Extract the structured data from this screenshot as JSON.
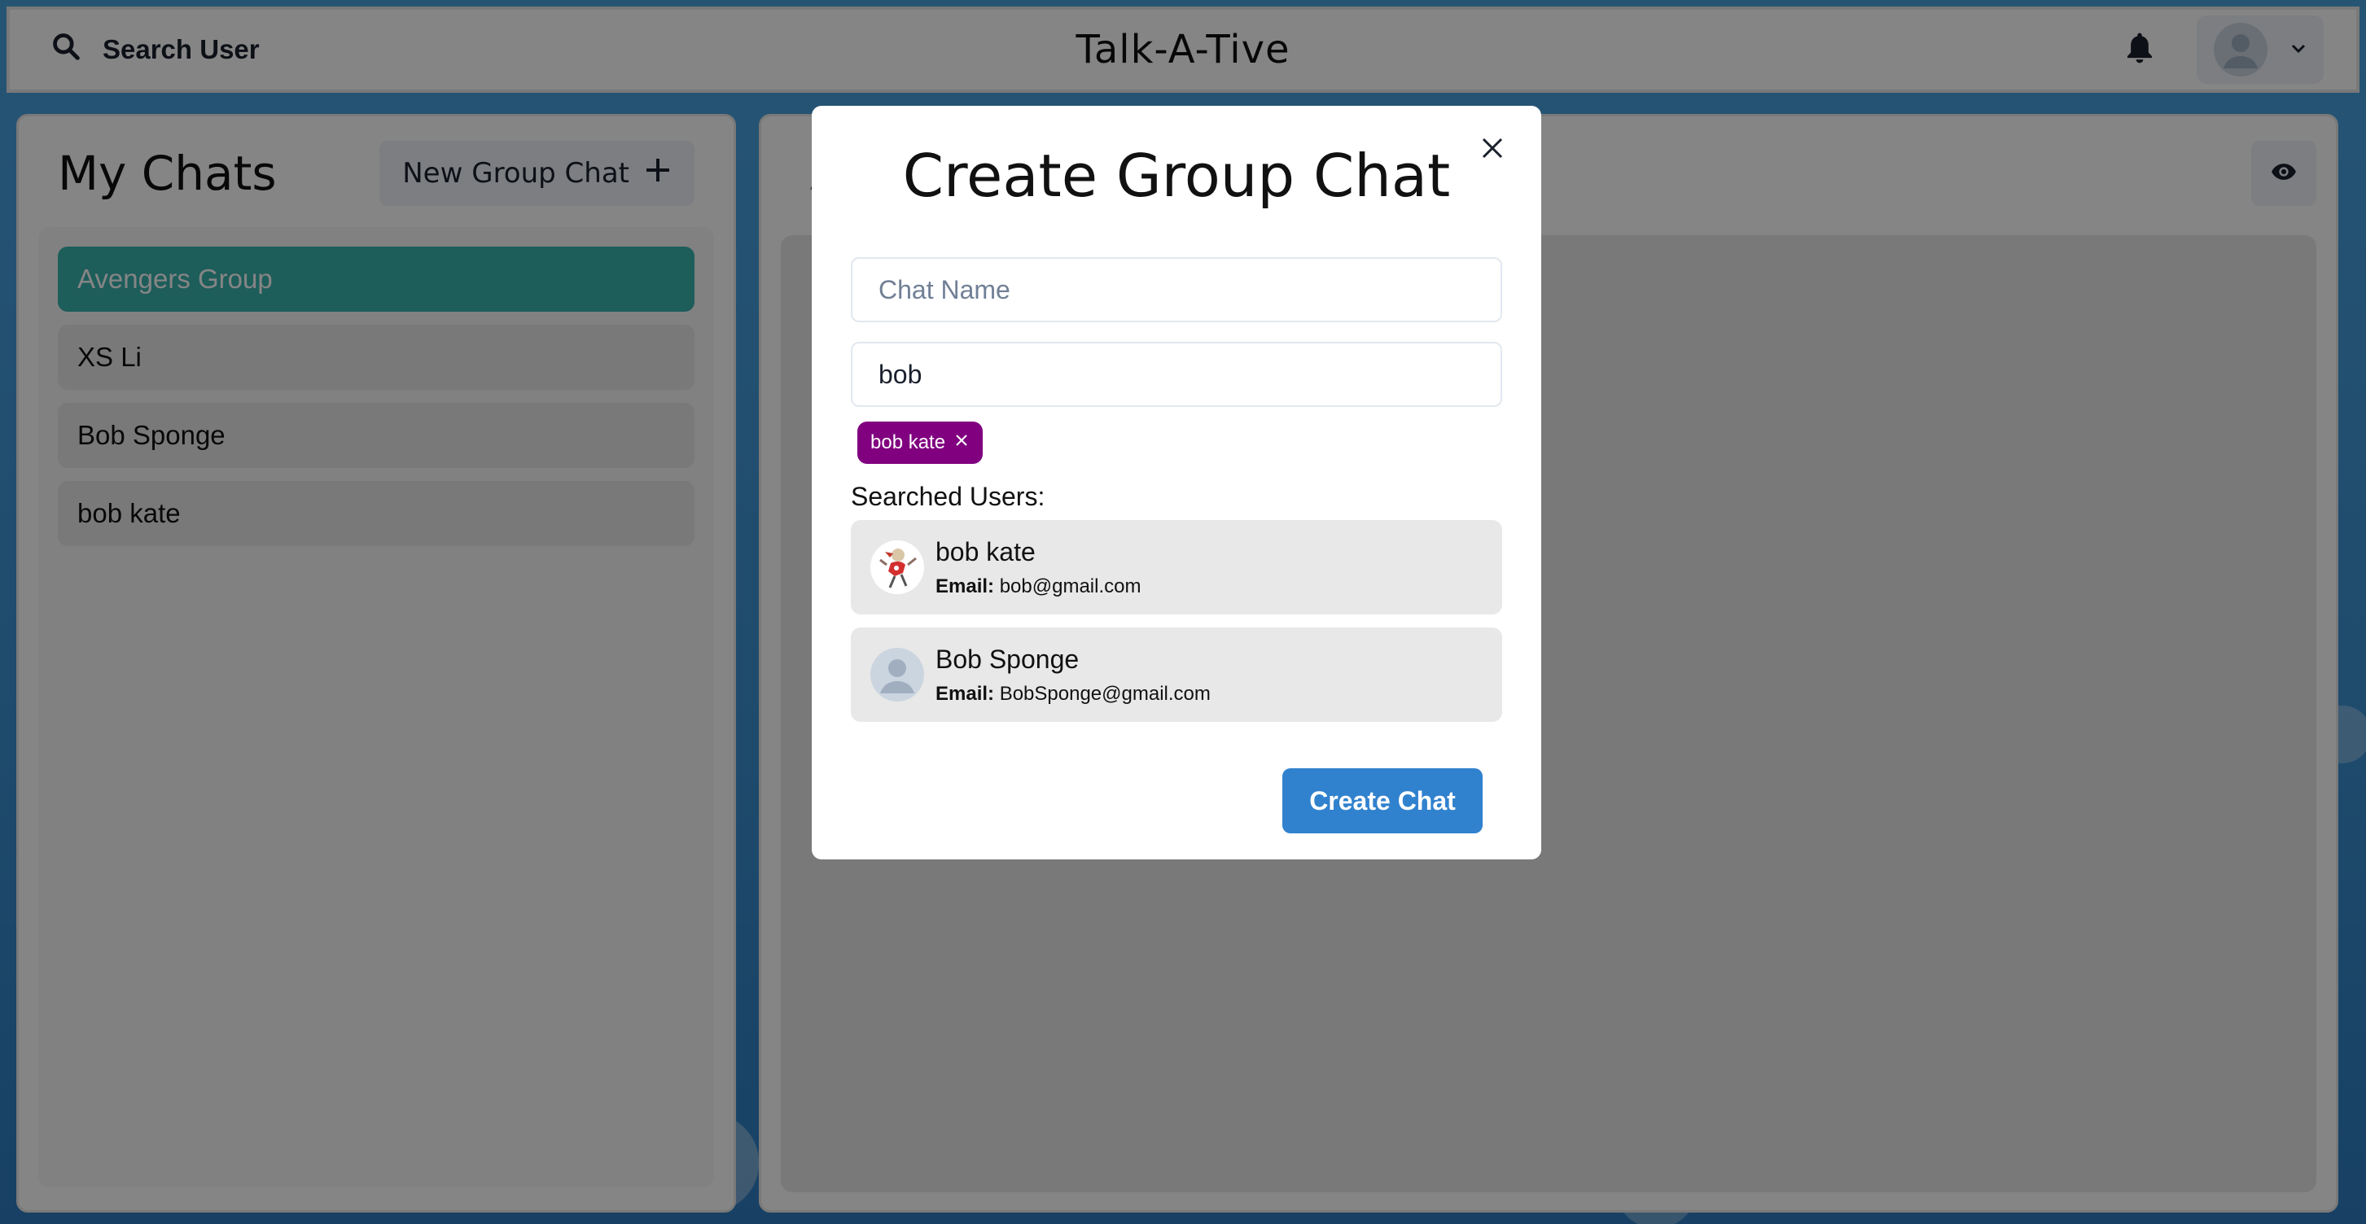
{
  "header": {
    "search_label": "Search User",
    "app_title": "Talk-A-Tive"
  },
  "my_chats": {
    "title": "My Chats",
    "new_group_label": "New Group Chat",
    "items": [
      {
        "label": "Avengers Group",
        "active": true
      },
      {
        "label": "XS Li",
        "active": false
      },
      {
        "label": "Bob Sponge",
        "active": false
      },
      {
        "label": "bob kate",
        "active": false
      }
    ]
  },
  "chatbox": {
    "title": "A"
  },
  "modal": {
    "title": "Create Group Chat",
    "chat_name_placeholder": "Chat Name",
    "chat_name_value": "",
    "search_value": "bob",
    "selected_users": [
      {
        "label": "bob kate"
      }
    ],
    "searched_label": "Searched Users:",
    "results": [
      {
        "name": "bob kate",
        "email_label": "Email:",
        "email": "bob@gmail.com",
        "avatar": "custom-avatar"
      },
      {
        "name": "Bob Sponge",
        "email_label": "Email:",
        "email": "BobSponge@gmail.com",
        "avatar": "default-avatar"
      }
    ],
    "create_label": "Create Chat"
  },
  "colors": {
    "active_chat": "#38b2ac",
    "tag": "#800080",
    "primary_button": "#3182ce"
  }
}
